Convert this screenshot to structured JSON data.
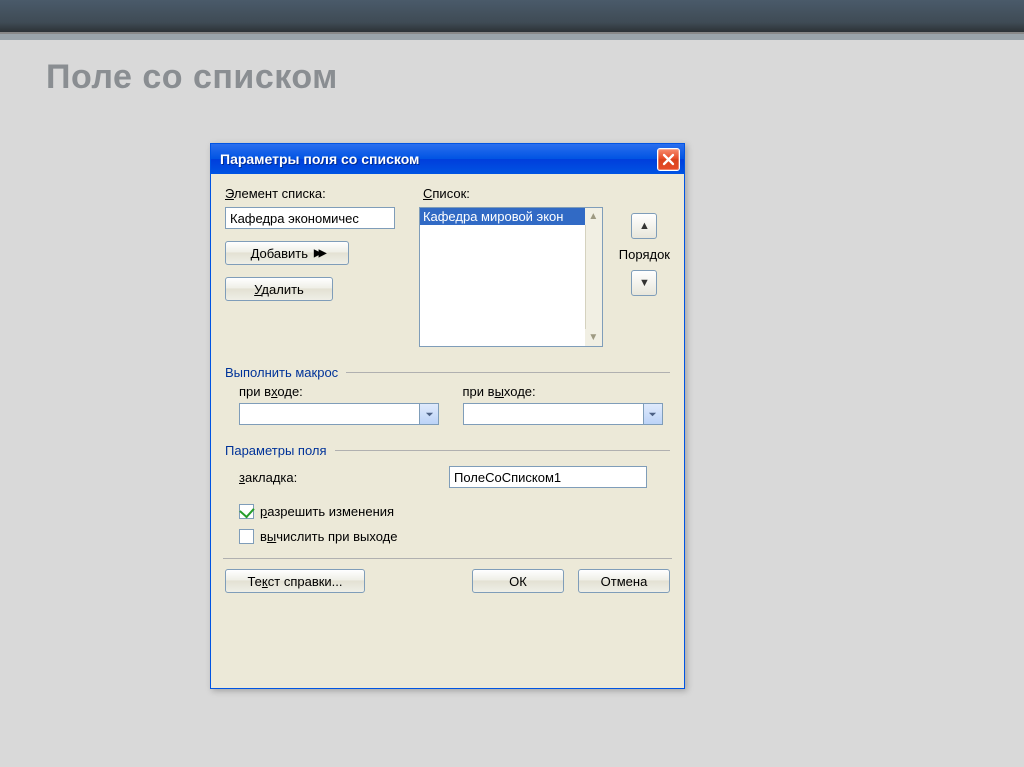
{
  "page": {
    "heading": "Поле со списком"
  },
  "dialog": {
    "title": "Параметры поля со списком"
  },
  "labels": {
    "list_element": "Элемент списка:",
    "list": "Список:",
    "order": "Порядок",
    "macro_section": "Выполнить макрос",
    "on_enter": "при входе:",
    "on_exit": "при выходе:",
    "field_params_section": "Параметры поля",
    "bookmark": "закладка:",
    "allow_changes": "разрешить изменения",
    "calc_on_exit": "вычислить при выходе"
  },
  "inputs": {
    "element_value": "Кафедра экономичес",
    "bookmark_value": "ПолеСоСписком1",
    "macro_enter_value": "",
    "macro_exit_value": ""
  },
  "list": {
    "items": [
      "Кафедра мировой экон"
    ]
  },
  "buttons": {
    "add": "Добавить",
    "remove": "Удалить",
    "help_text": "Текст справки...",
    "ok": "ОК",
    "cancel": "Отмена"
  },
  "checkboxes": {
    "allow_changes": true,
    "calc_on_exit": false
  }
}
